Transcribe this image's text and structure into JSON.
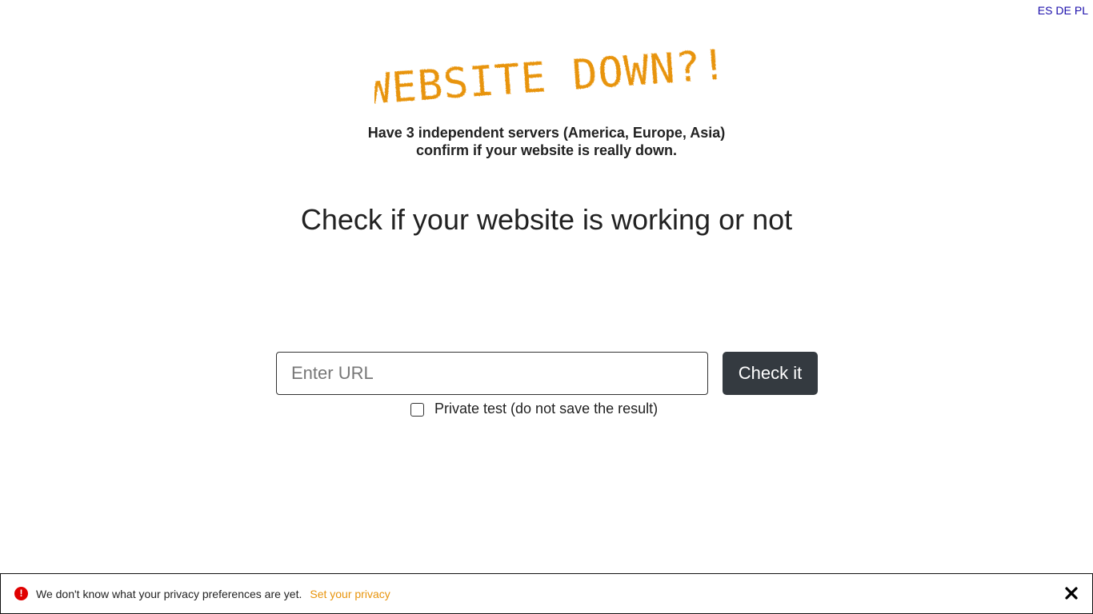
{
  "languages": [
    "ES",
    "DE",
    "PL"
  ],
  "logo": {
    "text": "WEBSITE DOWN?!",
    "color": "#e8940c"
  },
  "tagline": {
    "line1": "Have 3 independent servers (America, Europe, Asia)",
    "line2": "confirm if your website is really down."
  },
  "headline": "Check if your website is working or not",
  "form": {
    "url_placeholder": "Enter URL",
    "url_value": "",
    "submit_label": "Check it",
    "private_label": "Private test (do not save the result)",
    "private_checked": false
  },
  "privacy_bar": {
    "message": "We don't know what your privacy preferences are yet.",
    "link": "Set your privacy",
    "alert_icon": "exclamation-circle-icon",
    "close_icon": "close-icon"
  },
  "colors": {
    "accent": "#e8940c",
    "button": "#343a40",
    "link": "#1a0dab",
    "alert": "#e00000"
  }
}
